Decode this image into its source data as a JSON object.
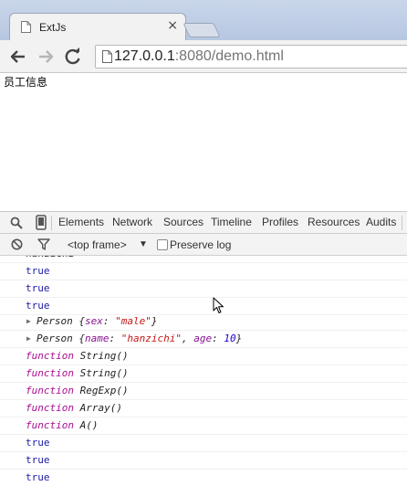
{
  "window": {
    "tab_title": "ExtJs",
    "tab_close": "×",
    "url_host": "127.0.0.1",
    "url_rest": ":8080/demo.html"
  },
  "page": {
    "heading": "员工信息"
  },
  "devtools": {
    "tabs": [
      "Elements",
      "Network",
      "Sources",
      "Timeline",
      "Profiles",
      "Resources",
      "Audits"
    ],
    "frame_selector": "<top frame>",
    "frame_arrow": "▼",
    "preserve_log": "Preserve log",
    "preserve_log_checked": false
  },
  "console": {
    "partial_top_line": "hanzichi",
    "bool_rows_1": [
      "true",
      "true",
      "true"
    ],
    "person_sex": {
      "prefix": "Person ",
      "open": "{",
      "key": "sex",
      "sep": ": ",
      "value": "\"male\"",
      "close": "}"
    },
    "person_name": {
      "prefix": "Person ",
      "open": "{",
      "key1": "name",
      "sep1": ": ",
      "value1": "\"hanzichi\"",
      "comma": ", ",
      "key2": "age",
      "sep2": ": ",
      "value2": "10",
      "close": "}"
    },
    "function_keyword": "function",
    "function_rows": [
      "String()",
      "String()",
      "RegExp()",
      "Array()",
      "A()"
    ],
    "bool_rows_2": [
      "true",
      "true",
      "true"
    ]
  },
  "colors": {
    "boolean": "#1a1aa6",
    "function_keyword": "#aa0d91",
    "string_value": "#c41a16",
    "number_value": "#1c00cf"
  }
}
